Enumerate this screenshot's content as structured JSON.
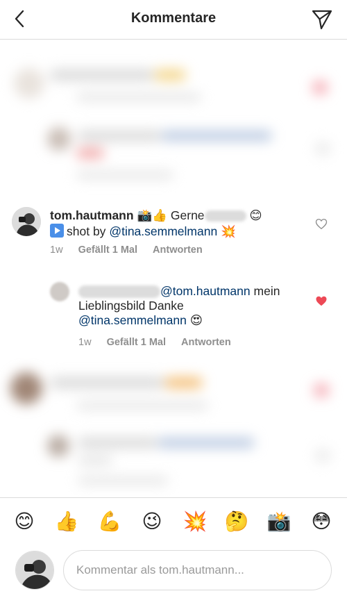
{
  "header": {
    "title": "Kommentare"
  },
  "comments": [
    {
      "username": "tom.hautmann",
      "text_part1": "Gerne",
      "line2_mid": "shot by",
      "mention": "@tina.semmelmann",
      "time": "1w",
      "likes": "Gefällt 1 Mal",
      "reply": "Antworten",
      "emoji_camera": "📸",
      "emoji_thumb": "👍",
      "emoji_smile": "😊",
      "emoji_boom": "💥"
    },
    {
      "mention1": "@tom.hautmann",
      "text_a": "mein",
      "text_b": "Lieblingsbild Danke",
      "mention2": "@tina.semmelmann",
      "emoji_hearteyes": "😍",
      "time": "1w",
      "likes": "Gefällt 1 Mal",
      "reply": "Antworten",
      "liked": true
    }
  ],
  "emoji_bar": [
    "😊",
    "👍",
    "💪",
    "😉",
    "💥",
    "🤔",
    "📸",
    "😳"
  ],
  "input": {
    "placeholder": "Kommentar als tom.hautmann..."
  },
  "colors": {
    "like_red": "#ed4956",
    "mention_blue": "#003569",
    "meta_grey": "#8e8e8e"
  }
}
